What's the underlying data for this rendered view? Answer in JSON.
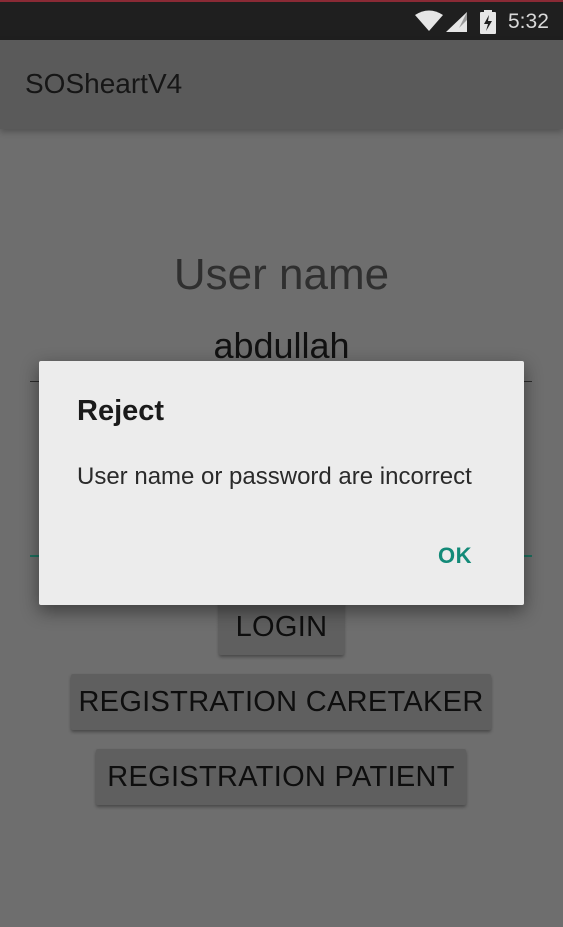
{
  "status_bar": {
    "time": "5:32",
    "icons": [
      "wifi-icon",
      "signal-icon",
      "battery-charging-icon"
    ]
  },
  "app_bar": {
    "title": "SOSheartV4"
  },
  "form": {
    "username_label": "User name",
    "username_value": "abdullah"
  },
  "buttons": {
    "login": "LOGIN",
    "registration_caretaker": "REGISTRATION CARETAKER",
    "registration_patient": "REGISTRATION PATIENT"
  },
  "dialog": {
    "title": "Reject",
    "message": "User name or password are incorrect",
    "ok_label": "OK"
  },
  "colors": {
    "accent": "#138a78",
    "status_bar": "#1f1f1f",
    "scrim_background": "#6e6e6e",
    "dialog_background": "#ececec"
  }
}
